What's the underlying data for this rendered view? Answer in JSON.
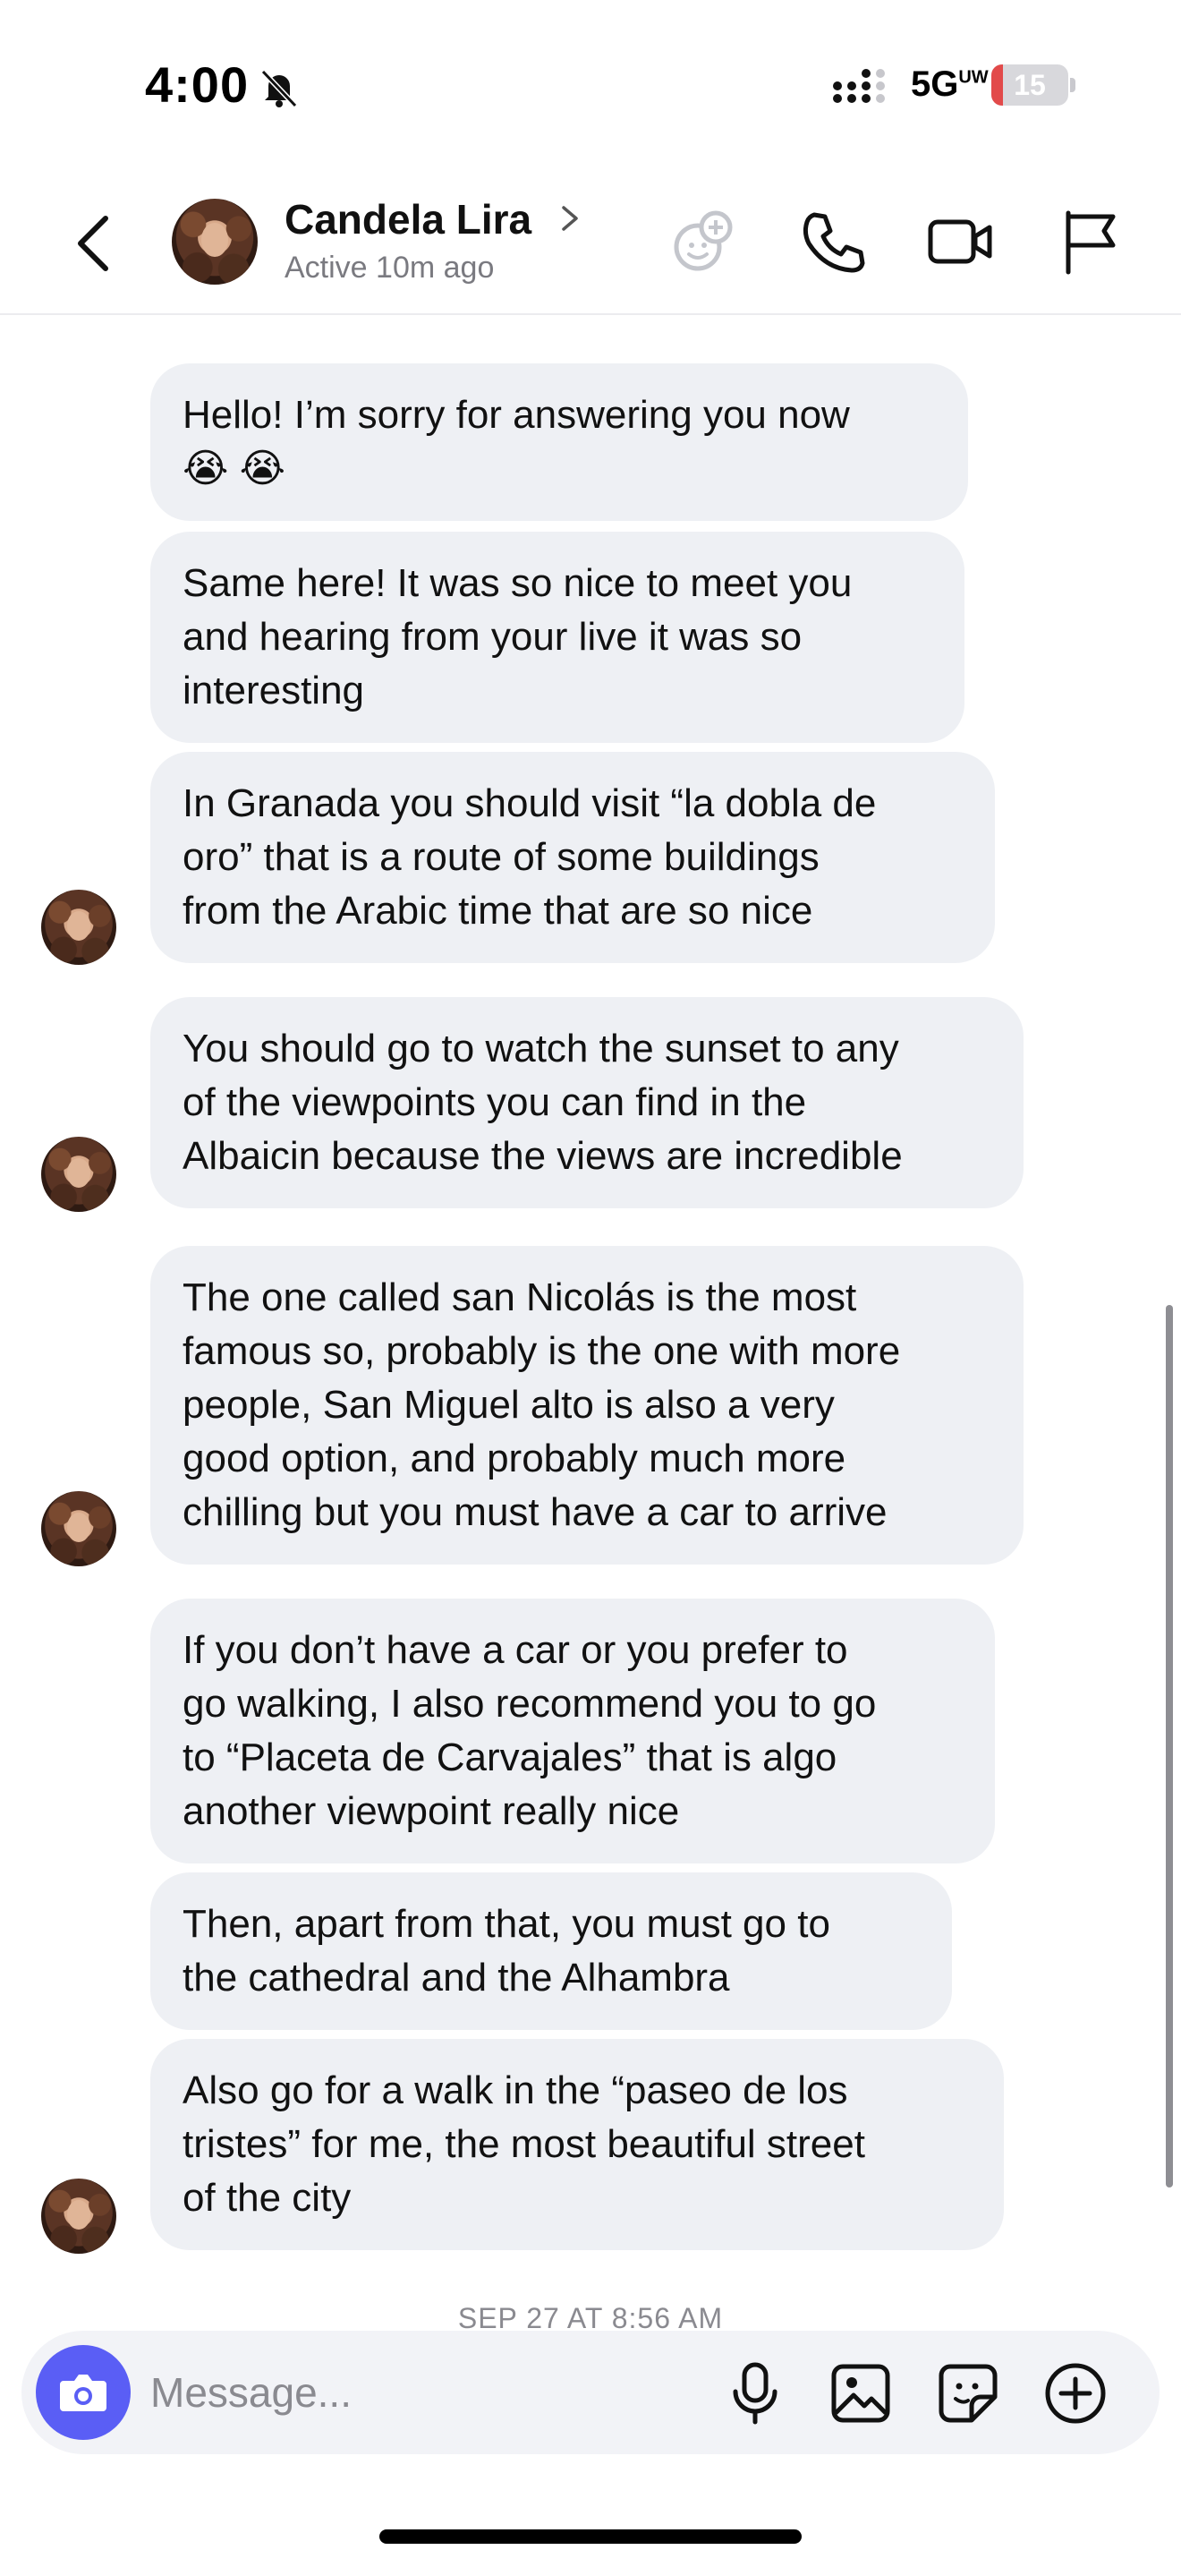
{
  "status_bar": {
    "time": "4:00",
    "network": "5G",
    "network_suffix": "UW",
    "battery_level": "15",
    "battery_fraction": 0.15,
    "icons": [
      "bell-slash-icon",
      "signal-bars-icon",
      "battery-icon"
    ]
  },
  "header": {
    "contact_name": "Candela Lira",
    "contact_status": "Active 10m ago",
    "icons": [
      "back-chevron-icon",
      "chevron-right-icon",
      "sticker-add-icon",
      "phone-icon",
      "video-camera-icon",
      "flag-icon"
    ]
  },
  "messages": [
    {
      "text": "Hello! I’m sorry for answering you now\n😭 😭",
      "show_avatar": false
    },
    {
      "text": "Same here! It was so nice to meet you\nand hearing from your live it was so\ninteresting",
      "show_avatar": false
    },
    {
      "text": "In Granada you should visit “la dobla de\noro” that is a route of some buildings\nfrom the Arabic time that are so nice",
      "show_avatar": true
    },
    {
      "text": "You should go to watch the sunset to any\nof the viewpoints you can find in the\nAlbaicin because the views are incredible",
      "show_avatar": true
    },
    {
      "text": "The one called san Nicolás is the most\nfamous so, probably is the one with more\npeople, San Miguel alto is also a very\ngood option, and probably much more\nchilling but you must have a car to arrive",
      "show_avatar": true
    },
    {
      "text": "If you don’t have a car or you prefer to\ngo walking, I also recommend you to go\nto “Placeta de Carvajales” that is algo\nanother viewpoint really nice",
      "show_avatar": false
    },
    {
      "text": "Then, apart from that, you must go to\nthe cathedral and the Alhambra",
      "show_avatar": false
    },
    {
      "text": "Also go for a walk in the “paseo de los\ntristes” for me, the most beautiful street\nof the city",
      "show_avatar": true
    }
  ],
  "timestamp": "SEP 27 AT 8:56 AM",
  "composer": {
    "placeholder": "Message...",
    "icons": [
      "camera-icon",
      "microphone-icon",
      "image-icon",
      "sticker-icon",
      "plus-circle-icon"
    ]
  }
}
